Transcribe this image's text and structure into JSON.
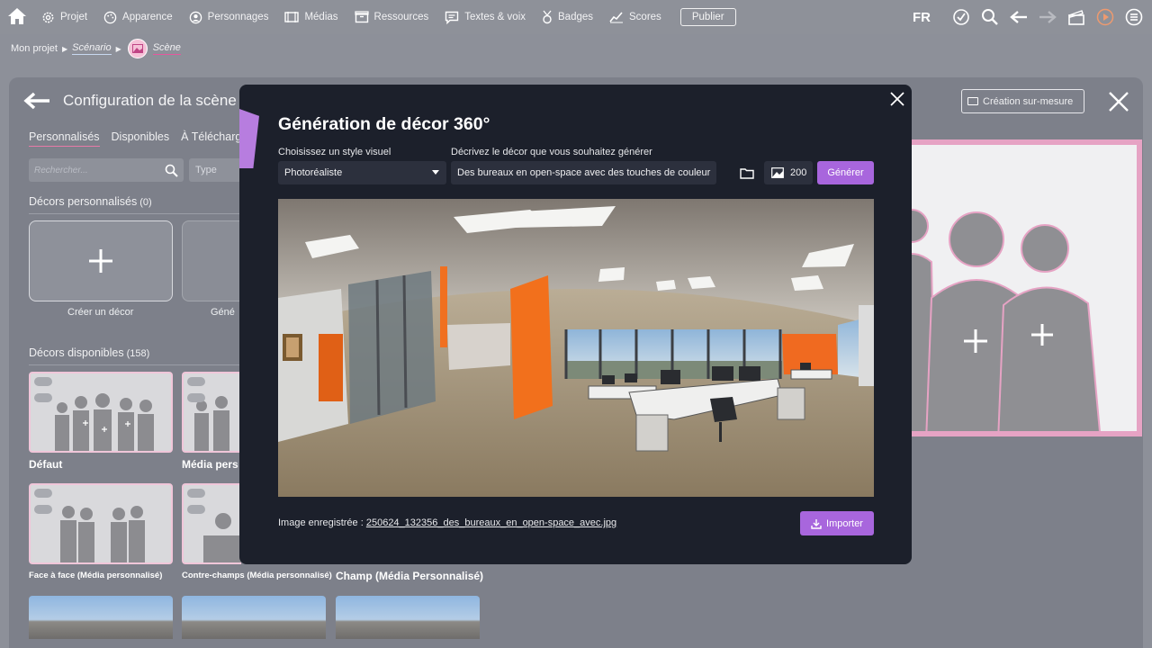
{
  "topbar": {
    "nav": [
      {
        "label": "Projet",
        "icon": "gear-icon"
      },
      {
        "label": "Apparence",
        "icon": "palette-icon"
      },
      {
        "label": "Personnages",
        "icon": "user-icon"
      },
      {
        "label": "Médias",
        "icon": "media-icon"
      },
      {
        "label": "Ressources",
        "icon": "box-icon"
      },
      {
        "label": "Textes & voix",
        "icon": "chat-icon"
      },
      {
        "label": "Badges",
        "icon": "badge-icon"
      },
      {
        "label": "Scores",
        "icon": "chart-icon"
      }
    ],
    "publish_label": "Publier",
    "lang": "FR"
  },
  "breadcrumb": {
    "root": "Mon projet",
    "scenario": "Scénario",
    "scene": "Scène"
  },
  "panel": {
    "title": "Configuration de la scène",
    "tabs": [
      "Personnalisés",
      "Disponibles",
      "À Télécharger"
    ],
    "search_placeholder": "Rechercher...",
    "type_filter": "Type",
    "custom_section": {
      "title": "Décors personnalisés",
      "count": "(0)"
    },
    "create_label": "Créer un décor",
    "generate_label_partial": "Géné",
    "available_section": {
      "title": "Décors disponibles",
      "count": "(158)"
    },
    "thumbs": [
      {
        "caption": "Défaut"
      },
      {
        "caption": "Média pers"
      },
      {
        "caption": "Face à face (Média personnalisé)"
      },
      {
        "caption": "Contre-champs (Média personnalisé)"
      },
      {
        "caption": "Champ (Média Personnalisé)"
      }
    ],
    "custom_button": "Création sur-mesure"
  },
  "modal": {
    "title": "Génération de décor 360°",
    "style_label": "Choisissez un style visuel",
    "style_value": "Photoréaliste",
    "prompt_label": "Décrivez le décor que vous souhaitez générer",
    "prompt_value": "Des bureaux en open-space avec des touches de couleur",
    "count_value": "200",
    "generate_button": "Générer",
    "saved_label": "Image enregistrée :",
    "saved_file": "250624_132356_des_bureaux_en_open-space_avec.jpg",
    "import_button": "Importer"
  },
  "colors": {
    "accent": "#a866dd",
    "pink": "#e6a3c4",
    "modal_bg": "#1c202b"
  }
}
